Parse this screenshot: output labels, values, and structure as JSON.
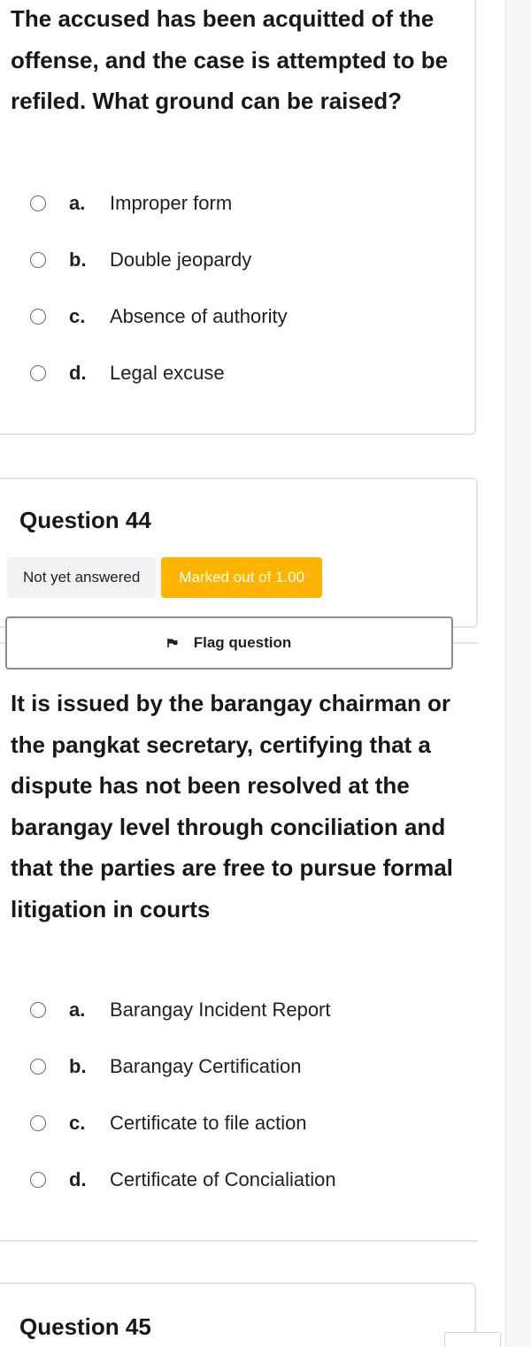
{
  "q43": {
    "text": "The accused has been acquitted of the offense, and the case is attempted to be refiled. What ground can be raised?",
    "options": [
      {
        "letter": "a.",
        "label": "Improper form"
      },
      {
        "letter": "b.",
        "label": "Double jeopardy"
      },
      {
        "letter": "c.",
        "label": "Absence of authority"
      },
      {
        "letter": "d.",
        "label": "Legal excuse"
      }
    ]
  },
  "q44": {
    "number": "Question 44",
    "status": "Not yet answered",
    "marks": "Marked out of 1.00",
    "flag_label": "Flag question",
    "text": "It is issued by the barangay chairman or the pangkat secretary, certifying that a dispute has not been resolved at the barangay level through conciliation and that the parties are free to pursue formal litigation in courts",
    "options": [
      {
        "letter": "a.",
        "label": "Barangay Incident Report"
      },
      {
        "letter": "b.",
        "label": "Barangay Certification"
      },
      {
        "letter": "c.",
        "label": "Certificate to file action"
      },
      {
        "letter": "d.",
        "label": "Certificate of Concialiation"
      }
    ]
  },
  "q45": {
    "number": "Question 45"
  },
  "colors": {
    "accent_amber": "#ffb400",
    "status_grey": "#f1f2f3",
    "border": "#e4e4e6"
  },
  "icons": {
    "flag": "flag-icon",
    "radio": "radio-unchecked-icon"
  }
}
